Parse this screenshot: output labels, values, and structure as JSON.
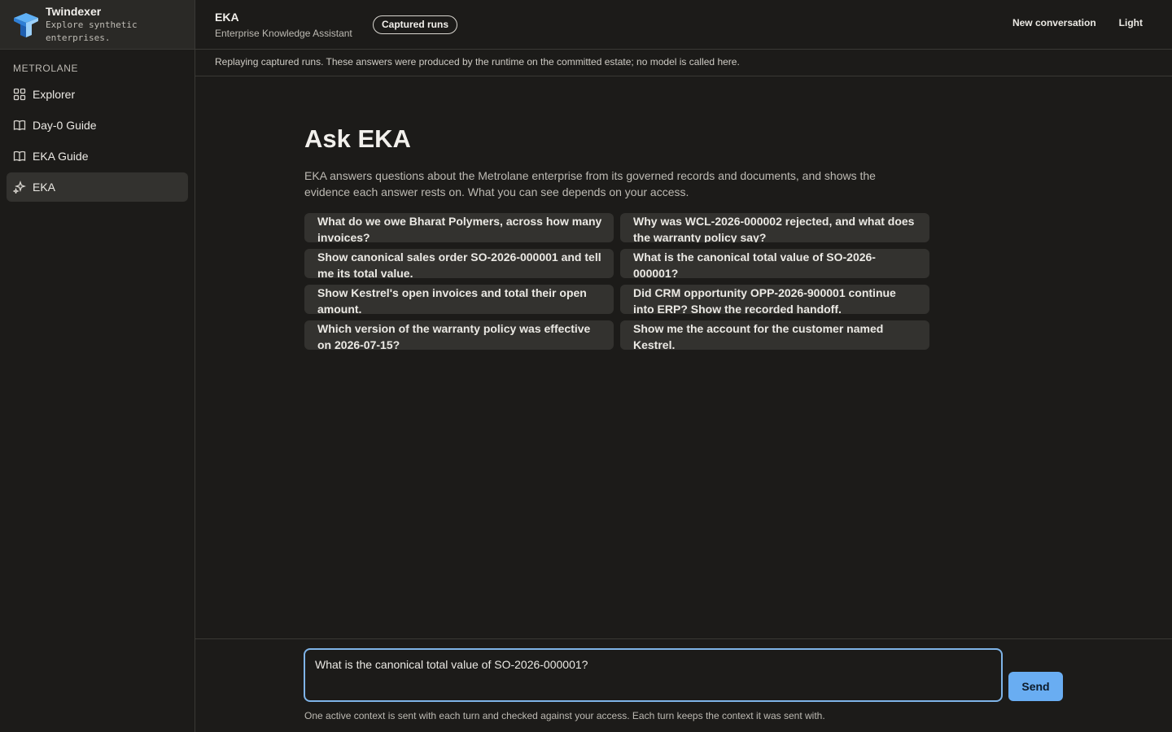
{
  "brand": {
    "name": "Twindexer",
    "tagline": "Explore synthetic enterprises."
  },
  "sidebar": {
    "section": "METROLANE",
    "items": [
      {
        "label": "Explorer",
        "icon": "grid-icon"
      },
      {
        "label": "Day-0 Guide",
        "icon": "book-icon"
      },
      {
        "label": "EKA Guide",
        "icon": "book-icon"
      },
      {
        "label": "EKA",
        "icon": "sparkle-icon",
        "active": true
      }
    ]
  },
  "topbar": {
    "title": "EKA",
    "subtitle": "Enterprise Knowledge Assistant",
    "badge": "Captured runs",
    "new_conversation": "New conversation",
    "theme": "Light"
  },
  "notice": "Replaying captured runs. These answers were produced by the runtime on the committed estate; no model is called here.",
  "main": {
    "heading": "Ask EKA",
    "intro": "EKA answers questions about the Metrolane enterprise from its governed records and documents, and shows the evidence each answer rests on. What you can see depends on your access.",
    "suggestions": [
      "What do we owe Bharat Polymers, across how many invoices?",
      "Why was WCL-2026-000002 rejected, and what does the warranty policy say?",
      "Show canonical sales order SO-2026-000001 and tell me its total value.",
      "What is the canonical total value of SO-2026-000001?",
      "Show Kestrel's open invoices and total their open amount.",
      "Did CRM opportunity OPP-2026-900001 continue into ERP? Show the recorded handoff.",
      "Which version of the warranty policy was effective on 2026-07-15?",
      "Show me the account for the customer named Kestrel."
    ]
  },
  "composer": {
    "value": "What is the canonical total value of SO-2026-000001?",
    "send_label": "Send",
    "footnote": "One active context is sent with each turn and checked against your access. Each turn keeps the context it was sent with."
  },
  "colors": {
    "accent": "#69adf2",
    "focus_border": "#7fb4e8",
    "background": "#1c1b19",
    "surface": "#33322f"
  }
}
